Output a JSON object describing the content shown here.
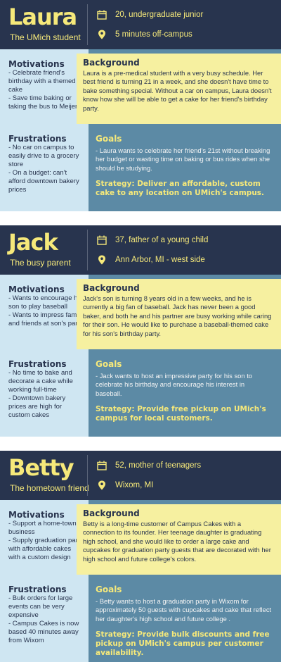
{
  "colors": {
    "navy": "#28344e",
    "yellow": "#f6e97a",
    "light_blue": "#cfe6f2",
    "steel_blue": "#5c8aa5",
    "pale_yellow": "#f6f0a0"
  },
  "personas": [
    {
      "name": "Laura",
      "subtitle": "The UMich student",
      "info1": "20, undergraduate junior",
      "info2": "5 minutes off-campus",
      "motivations_title": "Motivations",
      "motivations": [
        "- Celebrate friend's birthday with a themed cake",
        "- Save time baking or taking the bus to Meijer"
      ],
      "frustrations_title": "Frustrations",
      "frustrations": [
        "- No car on campus to easily drive to a grocery store",
        "- On a budget: can't afford downtown bakery prices"
      ],
      "background_title": "Background",
      "background": "Laura is a pre-medical student with a very busy schedule. Her best friend is turning 21 in a week, and she doesn't have time to bake something special. Without a car on campus, Laura doesn't know how she will be able to get a cake for her friend's birthday party.",
      "goals_title": "Goals",
      "goals": "- Laura wants to celebrate her friend's 21st without breaking her budget or wasting time on baking or bus rides when she should be studying.",
      "strategy": "Strategy: Deliver an affordable, custom cake to any location on UMich's campus."
    },
    {
      "name": "Jack",
      "subtitle": "The busy parent",
      "info1": "37, father of a young child",
      "info2": "Ann Arbor, MI - west side",
      "motivations_title": "Motivations",
      "motivations": [
        "- Wants to encourage his son to play baseball",
        "- Wants to impress family and friends at son's party"
      ],
      "frustrations_title": "Frustrations",
      "frustrations": [
        "- No time to bake and decorate a cake while working full-time",
        "- Downtown bakery prices are high for custom cakes"
      ],
      "background_title": "Background",
      "background": "Jack's son is turning 8 years old in a few weeks, and he is currently a big fan of baseball. Jack has never been a good baker, and both he and his partner are busy working while caring for their son. He would like to purchase a baseball-themed cake for his son's birthday party.",
      "goals_title": "Goals",
      "goals": "- Jack wants to host an impressive party for his son to celebrate his birthday and encourage his interest in baseball.",
      "strategy": "Strategy: Provide free pickup on UMich's campus for local customers."
    },
    {
      "name": "Betty",
      "subtitle": "The hometown friend",
      "info1": "52, mother of teenagers",
      "info2": "Wixom, MI",
      "motivations_title": "Motivations",
      "motivations": [
        "- Support a home-town business",
        "- Supply graduation party with affordable cakes with a custom design"
      ],
      "frustrations_title": "Frustrations",
      "frustrations": [
        "- Bulk orders for large events can be very expensive",
        "- Campus Cakes is now based 40 minutes away from Wixom"
      ],
      "background_title": "Background",
      "background": "Betty is a long-time customer of Campus Cakes with a connection to its founder. Her teenage daughter is graduating high school, and she would like to order a large cake and cupcakes for graduation party guests that are decorated with her high school and future college's colors.",
      "goals_title": "Goals",
      "goals": "- Betty wants to host a graduation party in Wixom for approximately 50 guests with cupcakes and cake that reflect her daughter's high school and future college .",
      "strategy": "Strategy: Provide bulk discounts and free pickup on UMich's campus per customer availability."
    }
  ]
}
